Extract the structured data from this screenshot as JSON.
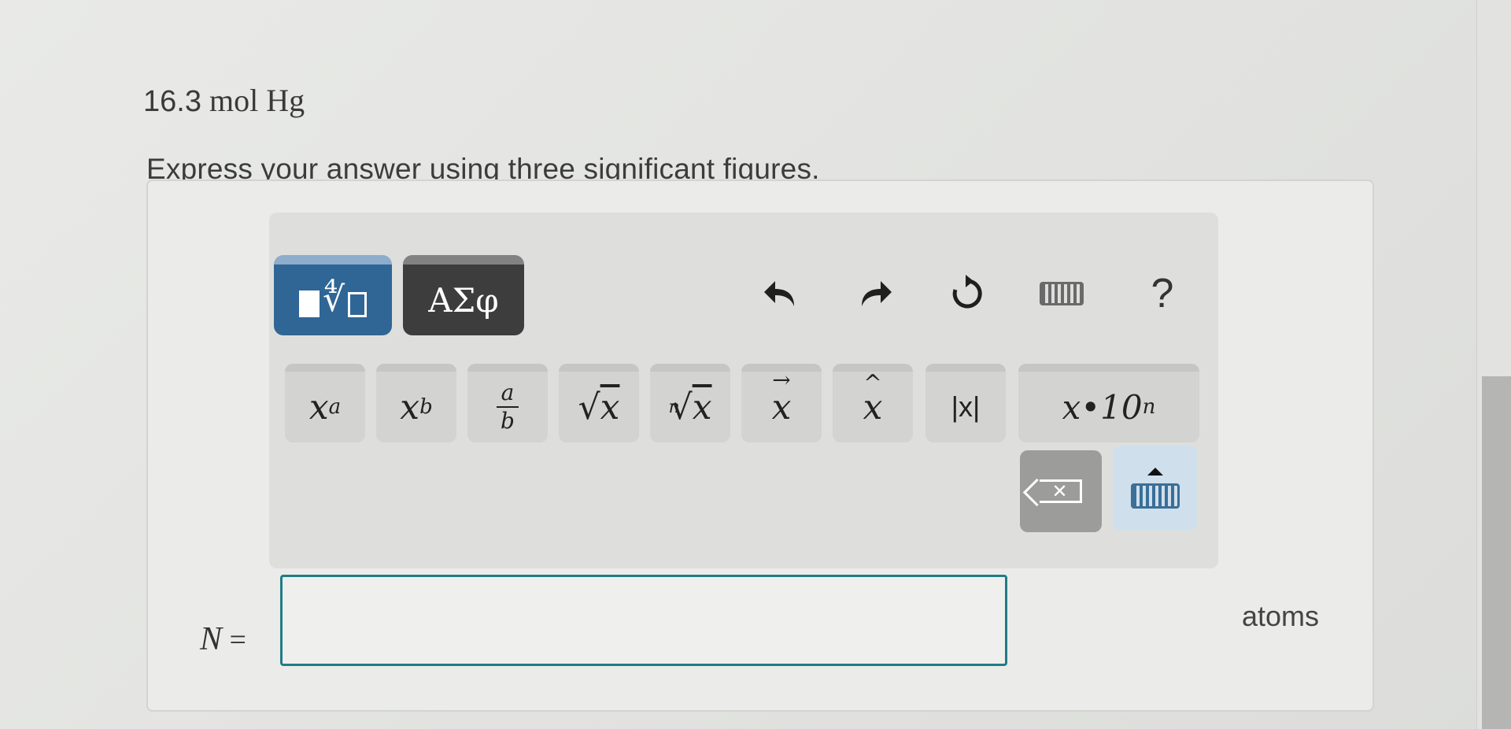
{
  "problem": {
    "quantity": "16.3",
    "unit": "mol Hg"
  },
  "instruction": "Express your answer using three significant figures.",
  "toolbar": {
    "templates_tab_icon": "templates-icon",
    "symbols_tab_label": "ΑΣφ",
    "undo_icon": "undo-icon",
    "redo_icon": "redo-icon",
    "reset_icon": "reset-icon",
    "keyboard_icon": "keyboard-icon",
    "help_label": "?"
  },
  "keys": {
    "superscript": {
      "base": "x",
      "exp": "a"
    },
    "subscript": {
      "base": "x",
      "sub": "b"
    },
    "fraction": {
      "num": "a",
      "den": "b"
    },
    "sqrt": {
      "sign": "√",
      "radicand": "x"
    },
    "nth_root": {
      "index": "n",
      "sign": "√",
      "radicand": "x"
    },
    "vector": {
      "base": "x"
    },
    "unit_vector": {
      "base": "x"
    },
    "absolute": "|x|",
    "sci_notation": {
      "base": "x•10",
      "exp": "n"
    }
  },
  "actions": {
    "backspace_icon": "backspace-icon",
    "keyboard_toggle_icon": "keyboard-toggle-icon"
  },
  "answer": {
    "variable": "N",
    "equals": "=",
    "value": "",
    "units": "atoms"
  },
  "colors": {
    "accent": "#2f6696",
    "input_border": "#1f7d86",
    "dark_tab": "#3d3d3d"
  }
}
